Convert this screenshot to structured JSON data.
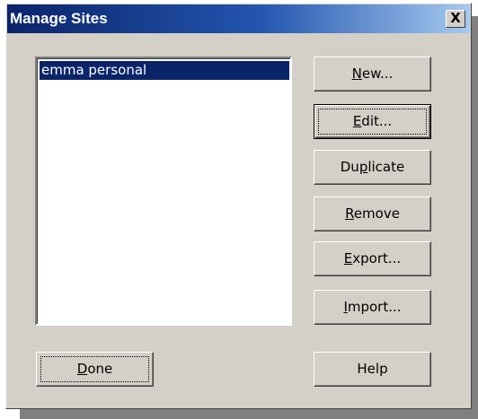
{
  "window": {
    "title": "Manage Sites",
    "close_glyph": "X"
  },
  "sites": {
    "items": [
      {
        "label": "emma personal",
        "selected": true
      }
    ]
  },
  "buttons": {
    "new": {
      "pre": "",
      "key": "N",
      "post": "ew..."
    },
    "edit": {
      "pre": "",
      "key": "E",
      "post": "dit..."
    },
    "duplicate": {
      "pre": "Du",
      "key": "p",
      "post": "licate"
    },
    "remove": {
      "pre": "",
      "key": "R",
      "post": "emove"
    },
    "export": {
      "pre": "",
      "key": "E",
      "post": "xport..."
    },
    "import": {
      "pre": "",
      "key": "I",
      "post": "mport..."
    },
    "done": {
      "pre": "",
      "key": "D",
      "post": "one"
    },
    "help": {
      "label": "Help"
    }
  },
  "colors": {
    "selection": "#0a246a",
    "face": "#d4d0c8",
    "titlebar_start": "#0a246a",
    "titlebar_end": "#a6caf0"
  }
}
